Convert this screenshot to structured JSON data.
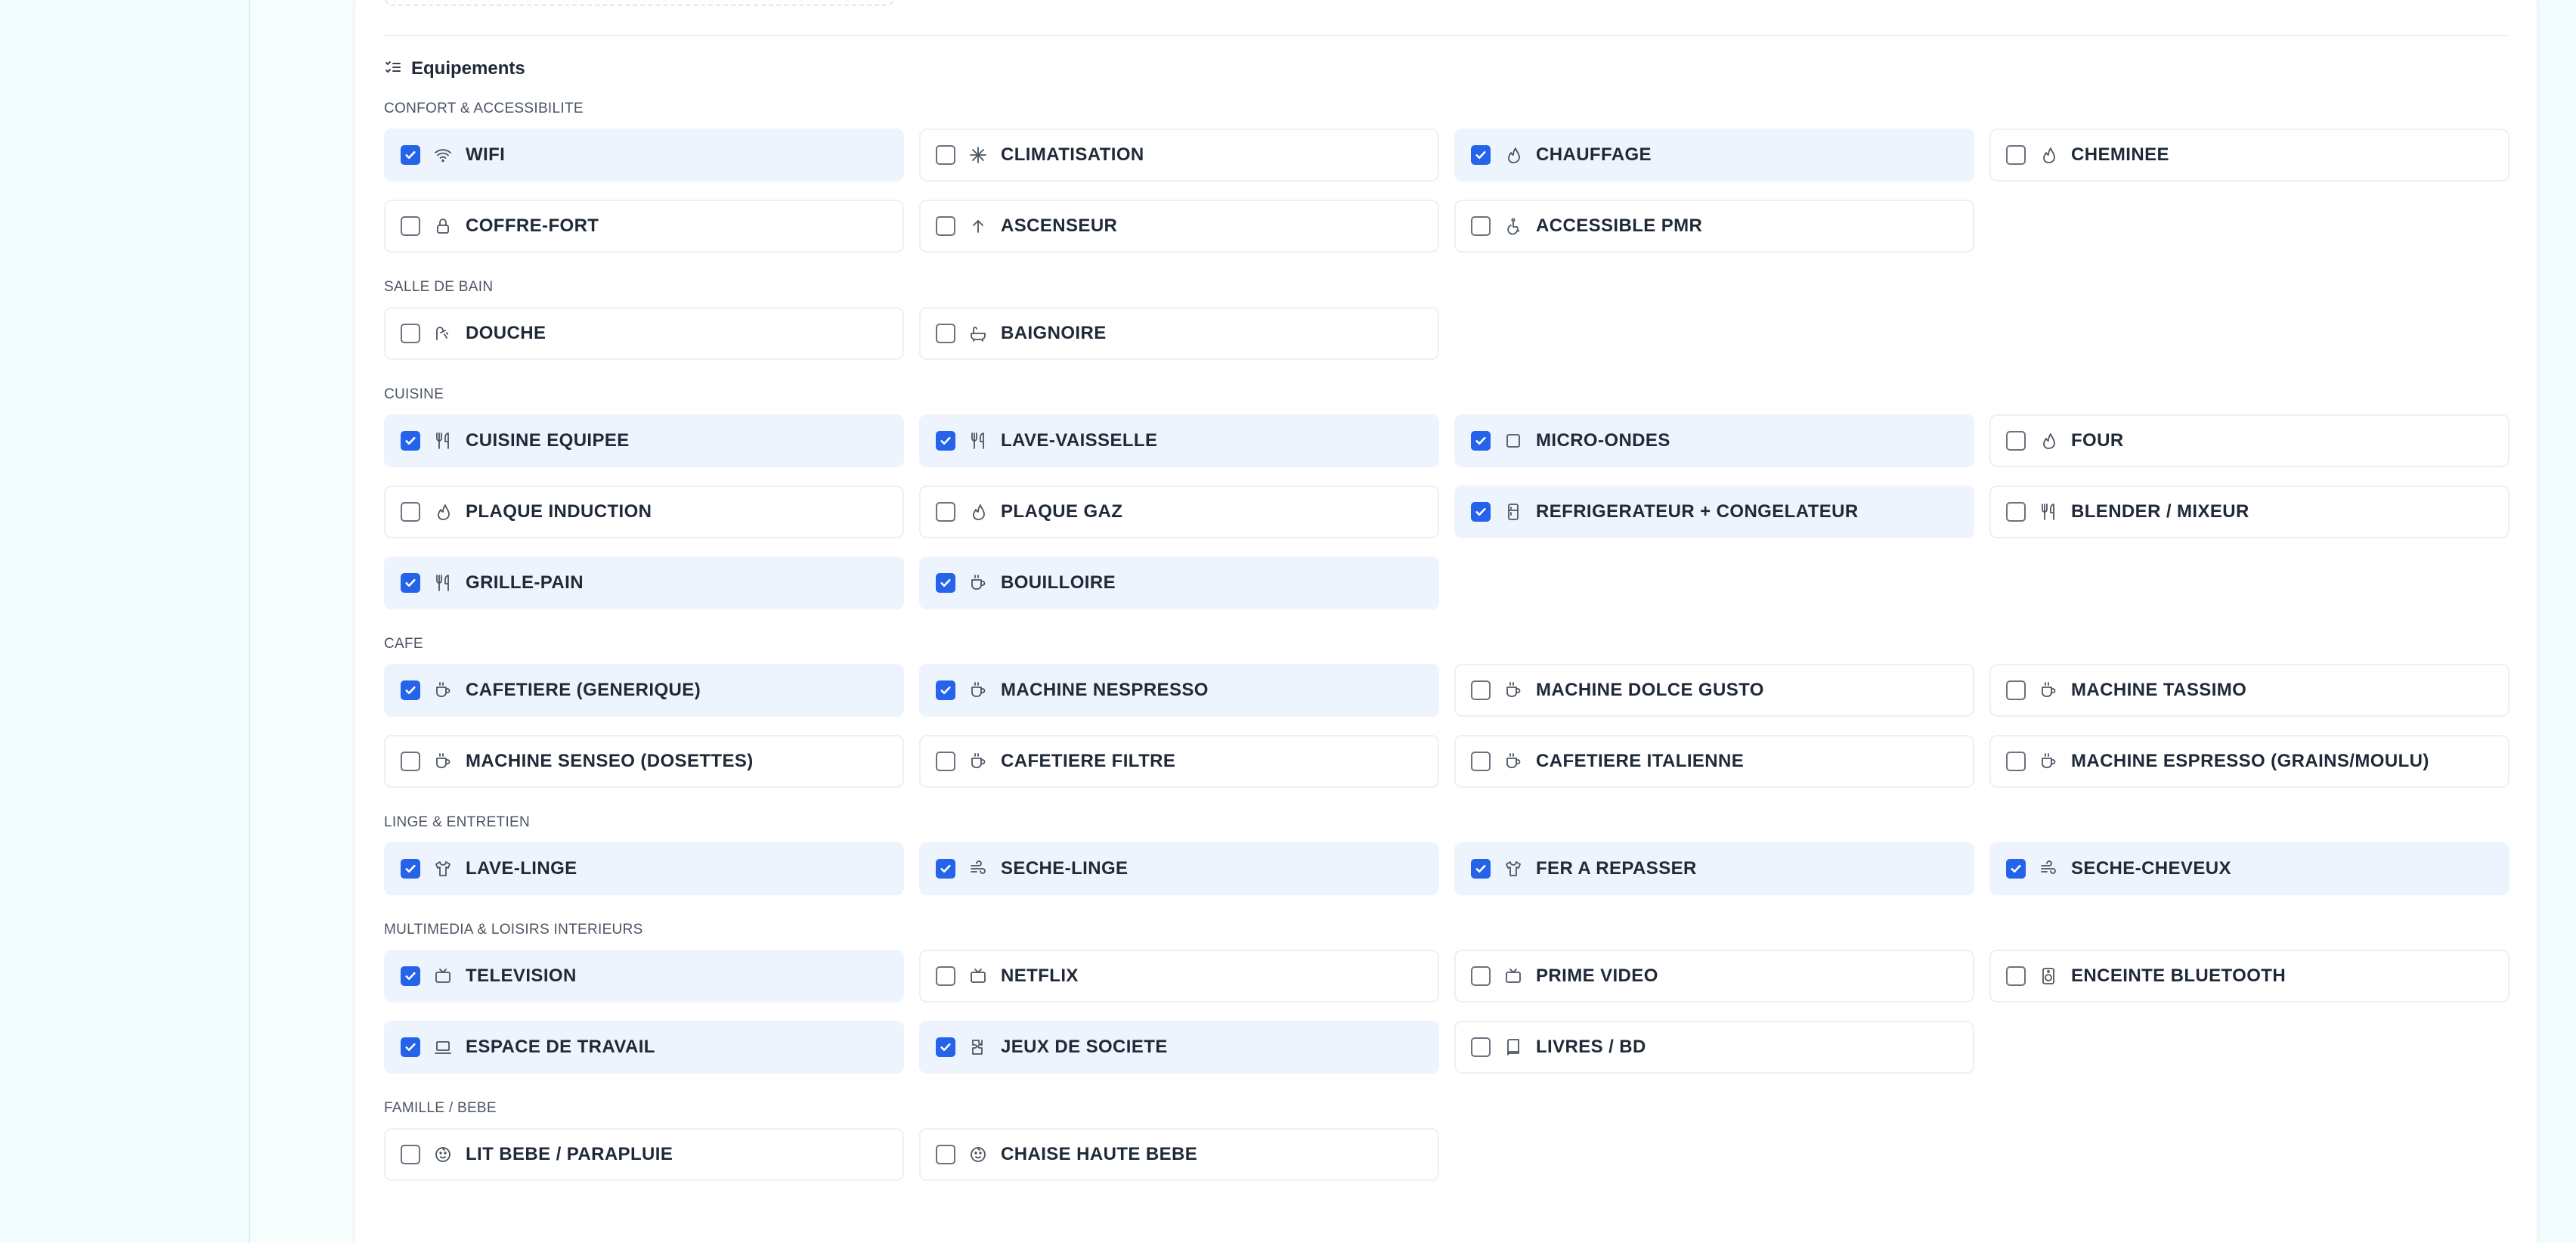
{
  "section": {
    "title": "Equipements",
    "icon": "checklist-icon"
  },
  "colors": {
    "accent": "#2563eb",
    "checked_bg": "#eef4fd"
  },
  "groups": [
    {
      "label": "CONFORT & ACCESSIBILITE",
      "items": [
        {
          "label": "WIFI",
          "checked": true,
          "icon": "wifi"
        },
        {
          "label": "CLIMATISATION",
          "checked": false,
          "icon": "snowflake"
        },
        {
          "label": "CHAUFFAGE",
          "checked": true,
          "icon": "flame"
        },
        {
          "label": "CHEMINEE",
          "checked": false,
          "icon": "flame"
        },
        {
          "label": "COFFRE-FORT",
          "checked": false,
          "icon": "lock"
        },
        {
          "label": "ASCENSEUR",
          "checked": false,
          "icon": "arrow-up"
        },
        {
          "label": "ACCESSIBLE PMR",
          "checked": false,
          "icon": "accessibility"
        }
      ]
    },
    {
      "label": "SALLE DE BAIN",
      "items": [
        {
          "label": "DOUCHE",
          "checked": false,
          "icon": "shower"
        },
        {
          "label": "BAIGNOIRE",
          "checked": false,
          "icon": "bath"
        }
      ]
    },
    {
      "label": "CUISINE",
      "items": [
        {
          "label": "CUISINE EQUIPEE",
          "checked": true,
          "icon": "utensils"
        },
        {
          "label": "LAVE-VAISSELLE",
          "checked": true,
          "icon": "utensils"
        },
        {
          "label": "MICRO-ONDES",
          "checked": true,
          "icon": "square"
        },
        {
          "label": "FOUR",
          "checked": false,
          "icon": "flame"
        },
        {
          "label": "PLAQUE INDUCTION",
          "checked": false,
          "icon": "flame"
        },
        {
          "label": "PLAQUE GAZ",
          "checked": false,
          "icon": "flame"
        },
        {
          "label": "REFRIGERATEUR + CONGELATEUR",
          "checked": true,
          "icon": "fridge"
        },
        {
          "label": "BLENDER / MIXEUR",
          "checked": false,
          "icon": "utensils"
        },
        {
          "label": "GRILLE-PAIN",
          "checked": true,
          "icon": "utensils"
        },
        {
          "label": "BOUILLOIRE",
          "checked": true,
          "icon": "cup"
        }
      ]
    },
    {
      "label": "CAFE",
      "items": [
        {
          "label": "CAFETIERE (GENERIQUE)",
          "checked": true,
          "icon": "cup"
        },
        {
          "label": "MACHINE NESPRESSO",
          "checked": true,
          "icon": "cup"
        },
        {
          "label": "MACHINE DOLCE GUSTO",
          "checked": false,
          "icon": "cup"
        },
        {
          "label": "MACHINE TASSIMO",
          "checked": false,
          "icon": "cup"
        },
        {
          "label": "MACHINE SENSEO (DOSETTES)",
          "checked": false,
          "icon": "cup"
        },
        {
          "label": "CAFETIERE FILTRE",
          "checked": false,
          "icon": "cup"
        },
        {
          "label": "CAFETIERE ITALIENNE",
          "checked": false,
          "icon": "cup"
        },
        {
          "label": "MACHINE ESPRESSO (GRAINS/MOULU)",
          "checked": false,
          "icon": "cup"
        }
      ]
    },
    {
      "label": "LINGE & ENTRETIEN",
      "items": [
        {
          "label": "LAVE-LINGE",
          "checked": true,
          "icon": "shirt"
        },
        {
          "label": "SECHE-LINGE",
          "checked": true,
          "icon": "wind"
        },
        {
          "label": "FER A REPASSER",
          "checked": true,
          "icon": "shirt"
        },
        {
          "label": "SECHE-CHEVEUX",
          "checked": true,
          "icon": "wind"
        }
      ]
    },
    {
      "label": "MULTIMEDIA & LOISIRS INTERIEURS",
      "items": [
        {
          "label": "TELEVISION",
          "checked": true,
          "icon": "tv"
        },
        {
          "label": "NETFLIX",
          "checked": false,
          "icon": "tv"
        },
        {
          "label": "PRIME VIDEO",
          "checked": false,
          "icon": "tv"
        },
        {
          "label": "ENCEINTE BLUETOOTH",
          "checked": false,
          "icon": "speaker"
        },
        {
          "label": "ESPACE DE TRAVAIL",
          "checked": true,
          "icon": "laptop"
        },
        {
          "label": "JEUX DE SOCIETE",
          "checked": true,
          "icon": "puzzle"
        },
        {
          "label": "LIVRES / BD",
          "checked": false,
          "icon": "book"
        }
      ]
    },
    {
      "label": "FAMILLE / BEBE",
      "items": [
        {
          "label": "LIT BEBE / PARAPLUIE",
          "checked": false,
          "icon": "baby"
        },
        {
          "label": "CHAISE HAUTE BEBE",
          "checked": false,
          "icon": "baby"
        }
      ]
    }
  ]
}
